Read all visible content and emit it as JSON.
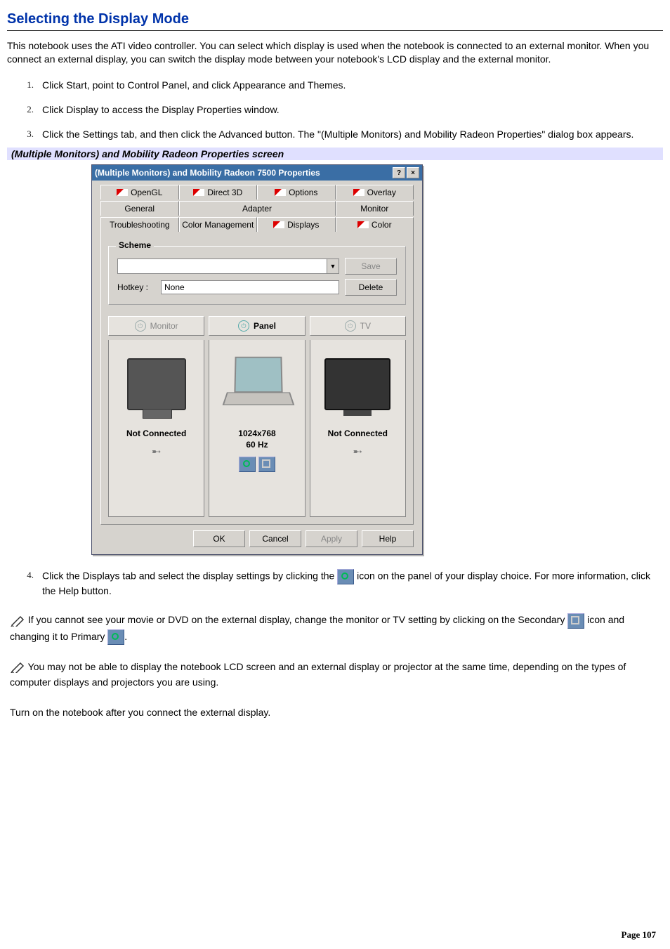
{
  "section_title": "Selecting the Display Mode",
  "intro": "This notebook uses the ATI video controller. You can select which display is used when the notebook is connected to an external monitor. When you connect an external display, you can switch the display mode between your notebook's LCD display and the external monitor.",
  "steps": {
    "s1": "Click Start, point to Control Panel, and click Appearance and Themes.",
    "s2": "Click Display to access the Display Properties window.",
    "s3": "Click the Settings tab, and then click the Advanced button. The \"(Multiple Monitors) and Mobility Radeon Properties\" dialog box appears.",
    "s4a": "Click the Displays tab and select the display settings by clicking the ",
    "s4b": " icon on the panel of your display choice. For more information, click the Help button."
  },
  "figure_caption": "(Multiple Monitors) and Mobility Radeon Properties screen",
  "note1": {
    "a": " If you cannot see your movie or DVD on the external display, change the monitor or TV setting by clicking on the Secondary ",
    "b": " icon and changing it to Primary "
  },
  "note2": "    You may not be able to display the notebook LCD screen and an external display or projector at the same time, depending on the types of computer displays and projectors you are using.",
  "note3": "Turn on the notebook after you connect the external display.",
  "page_footer": "Page 107",
  "dialog": {
    "title": "(Multiple Monitors) and Mobility Radeon 7500 Properties",
    "help_btn": "?",
    "close_btn": "×",
    "tabs_row1": {
      "t1": "OpenGL",
      "t2": "Direct 3D",
      "t3": "Options",
      "t4": "Overlay"
    },
    "tabs_row2": {
      "t1": "General",
      "t2": "Adapter",
      "t3": "Monitor"
    },
    "tabs_row3": {
      "t1": "Troubleshooting",
      "t2": "Color Management",
      "t3": "Displays",
      "t4": "Color"
    },
    "scheme_legend": "Scheme",
    "hotkey_label": "Hotkey :",
    "hotkey_value": "None",
    "save_btn": "Save",
    "delete_btn": "Delete",
    "targets": {
      "monitor": {
        "title": "Monitor",
        "status": "Not Connected"
      },
      "panel": {
        "title": "Panel",
        "res": "1024x768",
        "hz": "60 Hz"
      },
      "tv": {
        "title": "TV",
        "status": "Not Connected"
      }
    },
    "bottom": {
      "ok": "OK",
      "cancel": "Cancel",
      "apply": "Apply",
      "help": "Help"
    }
  }
}
